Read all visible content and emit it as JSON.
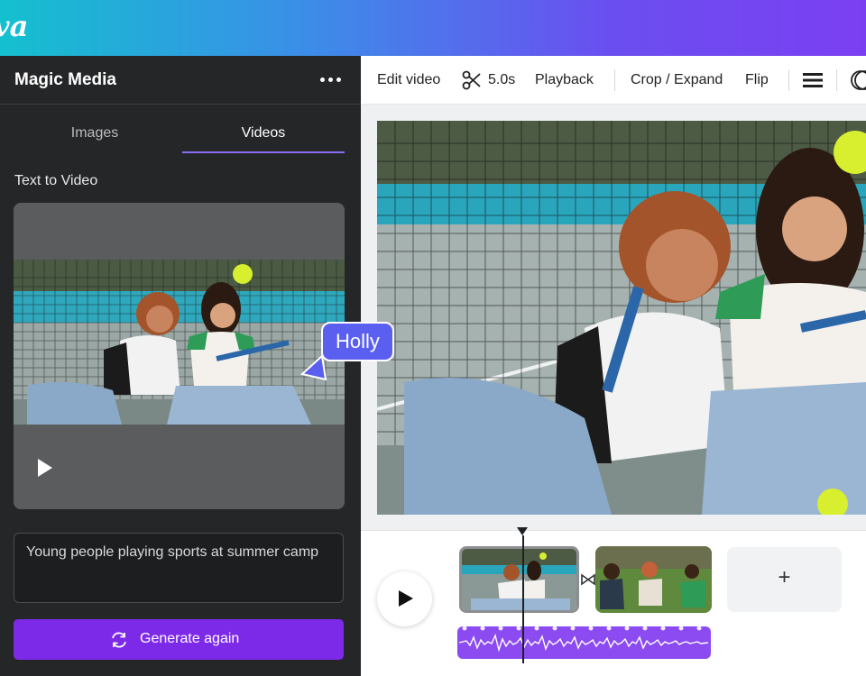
{
  "app": {
    "logo_text": "va"
  },
  "panel": {
    "title": "Magic Media",
    "more_icon": "more-horizontal-icon",
    "tabs": [
      {
        "label": "Images",
        "active": false
      },
      {
        "label": "Videos",
        "active": true
      }
    ],
    "section_label": "Text to Video",
    "prompt": "Young people playing sports at summer camp",
    "generate_label": "Generate again",
    "generate_icon": "refresh-icon"
  },
  "collaborator": {
    "name": "Holly"
  },
  "toolbar": {
    "edit_video": "Edit video",
    "duration": "5.0s",
    "playback": "Playback",
    "crop_expand": "Crop / Expand",
    "flip": "Flip"
  },
  "timeline": {
    "add_label": "+"
  },
  "colors": {
    "accent_purple": "#7d2ae8",
    "tab_underline": "#8b6cf6",
    "collaborator": "#5b5ff0",
    "audio_track": "#8b4bf0"
  }
}
